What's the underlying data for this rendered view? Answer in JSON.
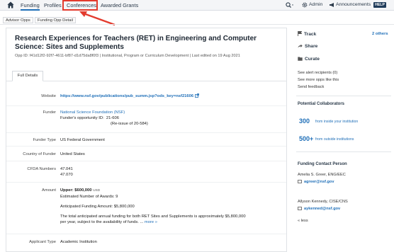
{
  "nav": {
    "tabs": [
      "Funding",
      "Profiles",
      "Conferences",
      "Awarded Grants"
    ],
    "search_icon": "search-icon",
    "admin": "Admin",
    "announcements": "Announcements",
    "help": "HELP"
  },
  "highlight_color": "#e33b2e",
  "breadcrumb": [
    "Advisor Opps",
    "Funding Opp Detail"
  ],
  "opp": {
    "title": "Research Experiences for Teachers (RET) in Engineering and Computer Science: Sites and Supplements",
    "meta": "Opp ID: f41d12f2-92f7-4611-bf87-d1d75da8f0f3   |   Institutional, Program or Curriculum Development   |   Last edited on 19 Aug 2021",
    "tab": "Full Details"
  },
  "details": {
    "website_label": "Website",
    "website": "https://www.nsf.gov/publications/pub_summ.jsp?ods_key=nsf21606",
    "funder_label": "Funder",
    "funder": "National Science Foundation (NSF)",
    "funder_opp_id_label": "Funder's opportunity ID:",
    "funder_opp_id": "21-606",
    "reissue": "(Re-issue of 20-584)",
    "funder_type_label": "Funder Type",
    "funder_type": "US Federal Government",
    "country_label": "Country of Funder",
    "country": "United States",
    "cfda_label": "CFDA Numbers",
    "cfda": [
      "47.041",
      "47.070"
    ],
    "amount_label": "Amount",
    "upper": "Upper:  $600,000",
    "upper_unit": "USD",
    "awards": "Estimated Number of Awards: 9",
    "anticipated": "Anticipated Funding Amount: $5,800,000",
    "note1": "The total anticipated annual funding for both RET Sites and Supplements is approximately $5,800,000",
    "note2": "per year, subject to the availability of funds. ...",
    "more": "more »",
    "applicant_label": "Applicant Type",
    "applicant": "Academic Institution"
  },
  "sidebar": {
    "track": "Track",
    "followers": "2 others",
    "share": "Share",
    "curate": "Curate",
    "alert": "See alert recipients  (0)",
    "more_opps": "See more opps like this",
    "feedback": "Send feedback",
    "collab_head": "Potential Collaborators",
    "inside_num": "300",
    "inside_lbl": "from inside your institution",
    "outside_num": "500+",
    "outside_lbl": "from outside institutions",
    "contact_head": "Funding Contact Person",
    "contact1_name": "Amelia S. Greer, ENG/EEC",
    "contact1_email": "agreer@nsf.gov",
    "contact2_name": "Allyson Kennedy, CISE/CNS",
    "contact2_email": "aykenned@nsf.gov",
    "less": "« less"
  }
}
